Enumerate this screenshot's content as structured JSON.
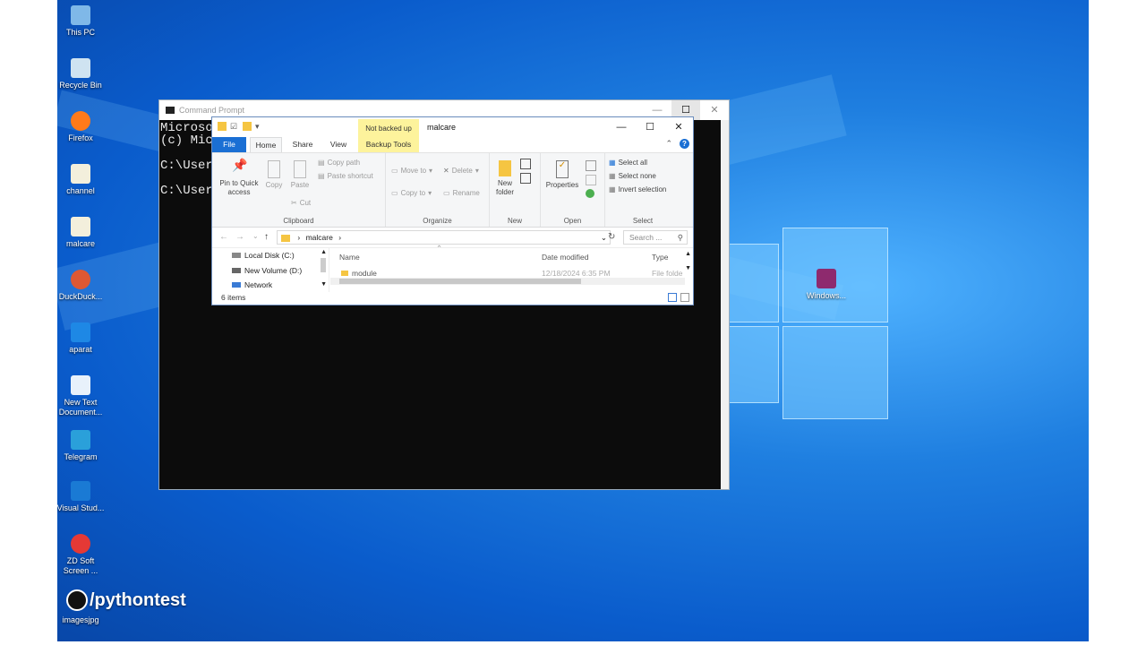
{
  "desktop": {
    "icons": [
      {
        "label": "This PC",
        "icon": "this-pc-icon",
        "color": "#7fb8e8"
      },
      {
        "label": "Recycle Bin",
        "icon": "recycle-bin-icon",
        "color": "#cfe3f1"
      },
      {
        "label": "Firefox",
        "icon": "firefox-icon",
        "color": "#ff7a1a"
      },
      {
        "label": "channel",
        "icon": "document-icon",
        "color": "#f3efdc"
      },
      {
        "label": "malcare",
        "icon": "document-icon",
        "color": "#f3efdc"
      },
      {
        "label": "DuckDuck...",
        "icon": "duckduckgo-icon",
        "color": "#de5833"
      },
      {
        "label": "aparat",
        "icon": "aparat-icon",
        "color": "#1e88e5"
      },
      {
        "label": "New Text Document...",
        "icon": "text-document-icon",
        "color": "#e8f1fb"
      },
      {
        "label": "Telegram",
        "icon": "telegram-icon",
        "color": "#2aa0da"
      },
      {
        "label": "Visual Stud...",
        "icon": "vscode-icon",
        "color": "#1a7ad4"
      },
      {
        "label": "ZD Soft Screen ...",
        "icon": "zd-soft-icon",
        "color": "#e53935"
      },
      {
        "label": "imagesjpg",
        "icon": "image-file-icon",
        "color": "#333333"
      }
    ],
    "right_icon": {
      "label": "Windows...",
      "icon": "winrar-icon",
      "color": "#8e2a6e"
    },
    "watermark": "/pythontest"
  },
  "cmd": {
    "title": "Command Prompt",
    "lines": [
      "Microso",
      "(c) Mic",
      "",
      "C:\\User",
      "",
      "C:\\User"
    ]
  },
  "explorer": {
    "title": "malcare",
    "context_tab": "Not backed up",
    "context_subtab": "Backup Tools",
    "tabs": [
      "File",
      "Home",
      "Share",
      "View"
    ],
    "ribbon": {
      "clipboard": {
        "pin": "Pin to Quick access",
        "copy": "Copy",
        "paste": "Paste",
        "copy_path": "Copy path",
        "paste_shortcut": "Paste shortcut",
        "cut": "Cut",
        "label": "Clipboard"
      },
      "organize": {
        "move_to": "Move to",
        "copy_to": "Copy to",
        "delete": "Delete",
        "rename": "Rename",
        "label": "Organize"
      },
      "new": {
        "new_folder": "New folder",
        "label": "New"
      },
      "open": {
        "properties": "Properties",
        "label": "Open"
      },
      "select": {
        "select_all": "Select all",
        "select_none": "Select none",
        "invert": "Invert selection",
        "label": "Select"
      }
    },
    "address": {
      "path": "malcare",
      "search_placeholder": "Search ..."
    },
    "nav": [
      "Local Disk (C:)",
      "New Volume (D:)",
      "Network"
    ],
    "columns": [
      "Name",
      "Date modified",
      "Type"
    ],
    "rows": [
      {
        "name": "module",
        "date": "12/18/2024 6:35 PM",
        "type": "File folde"
      }
    ],
    "status": "6 items"
  }
}
